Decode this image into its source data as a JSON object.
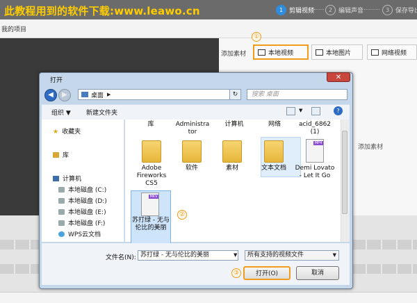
{
  "banner": {
    "text": "此教程用到的软件下载:www.leawo.cn",
    "color": "#ffcc00"
  },
  "steps": [
    {
      "num": "1",
      "label": "剪辑视频",
      "active": true
    },
    {
      "num": "2",
      "label": "编辑声音",
      "active": false
    },
    {
      "num": "3",
      "label": "保存导出",
      "active": false
    }
  ],
  "project_tab": "我的项目",
  "materials": {
    "label": "添加素材",
    "buttons": [
      "本地视频",
      "本地图片",
      "网络视频"
    ]
  },
  "right_hint": "添加素材",
  "dialog": {
    "title": "打开",
    "close": "✕",
    "address": "桌面",
    "search_placeholder": "搜索 桌面",
    "toolbar": {
      "organize": "组织 ▼",
      "new_folder": "新建文件夹",
      "help": "?"
    },
    "sidebar": {
      "favorites": "收藏夹",
      "libraries": "库",
      "computer": "计算机",
      "drives": [
        "本地磁盘 (C:)",
        "本地磁盘 (D:)",
        "本地磁盘 (E:)",
        "本地磁盘 (F:)"
      ],
      "wps": "WPS云文档"
    },
    "top_row": [
      "库",
      "Administra tor",
      "计算机",
      "网络",
      "acid_6862 (1)"
    ],
    "files": [
      {
        "label": "Adobe Fireworks CS5",
        "kind": "folder"
      },
      {
        "label": "软件",
        "kind": "folder"
      },
      {
        "label": "素材",
        "kind": "folder"
      },
      {
        "label": "文本文档",
        "kind": "folder"
      },
      {
        "label": "Demi Lovato - Let It Go",
        "kind": "video",
        "tag": "MP4"
      }
    ],
    "selected_file": {
      "label": "苏打绿 - 无与伦比的美丽",
      "tag": "MKV"
    },
    "filename_label": "文件名(N):",
    "filename_value": "苏打绿 - 无与伦比的美丽",
    "filetype_value": "所有支持的视频文件",
    "open_button": "打开(O)",
    "cancel_button": "取消"
  },
  "callouts": [
    "①",
    "②",
    "③"
  ],
  "colors": {
    "accent": "#f39b1a",
    "step_active": "#2f8de0",
    "selection": "#cde4fb"
  }
}
